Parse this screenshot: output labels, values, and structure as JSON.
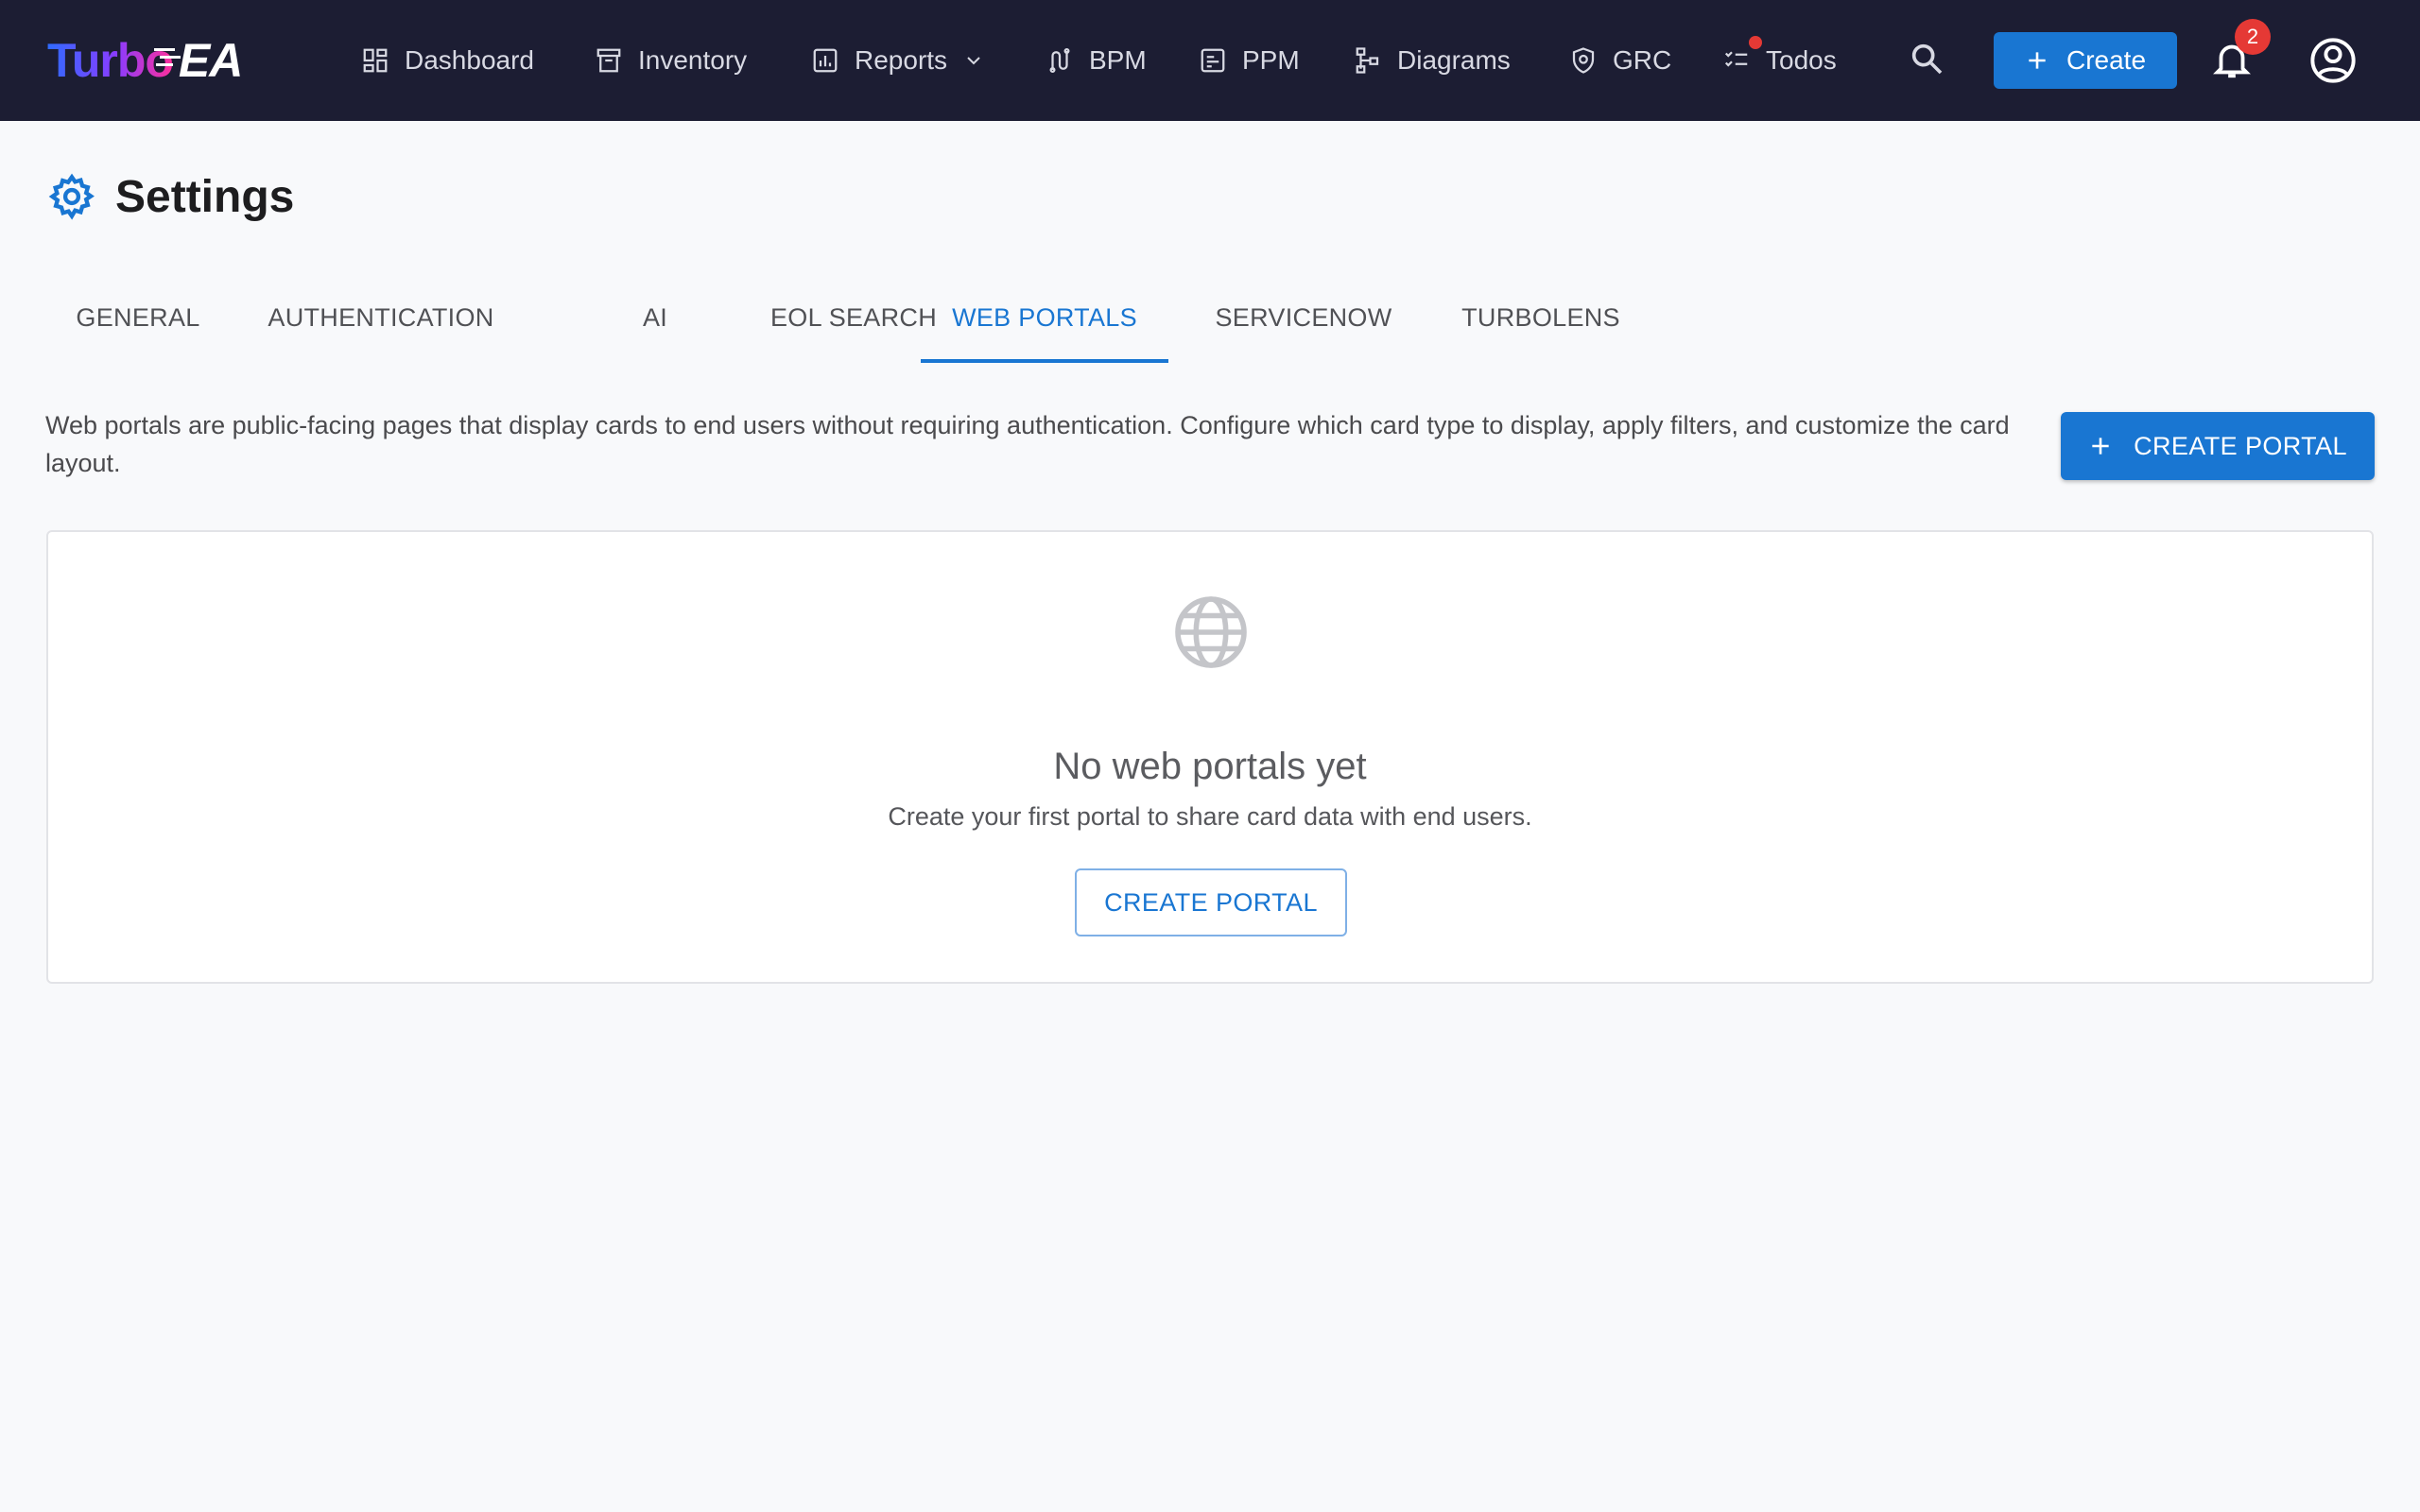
{
  "app": {
    "logo_turbo": "Turbo",
    "logo_ea": "EA"
  },
  "nav": {
    "dashboard": "Dashboard",
    "inventory": "Inventory",
    "reports": "Reports",
    "bpm": "BPM",
    "ppm": "PPM",
    "diagrams": "Diagrams",
    "grc": "GRC",
    "todos": "Todos",
    "create": "Create",
    "notification_count": "2"
  },
  "page": {
    "title": "Settings"
  },
  "tabs": [
    {
      "label": "GENERAL"
    },
    {
      "label": "AUTHENTICATION"
    },
    {
      "label": "AI"
    },
    {
      "label": "EOL SEARCH"
    },
    {
      "label": "WEB PORTALS"
    },
    {
      "label": "SERVICENOW"
    },
    {
      "label": "TURBOLENS"
    }
  ],
  "active_tab": "WEB PORTALS",
  "web_portals": {
    "description": "Web portals are public-facing pages that display cards to end users without requiring authentication. Configure which card type to display, apply filters, and customize the card layout.",
    "create_button": "CREATE PORTAL",
    "empty_title": "No web portals yet",
    "empty_subtitle": "Create your first portal to share card data with end users.",
    "empty_button": "CREATE PORTAL"
  },
  "colors": {
    "topbar": "#1c1d33",
    "accent": "#1976d2",
    "badge": "#e53935"
  }
}
